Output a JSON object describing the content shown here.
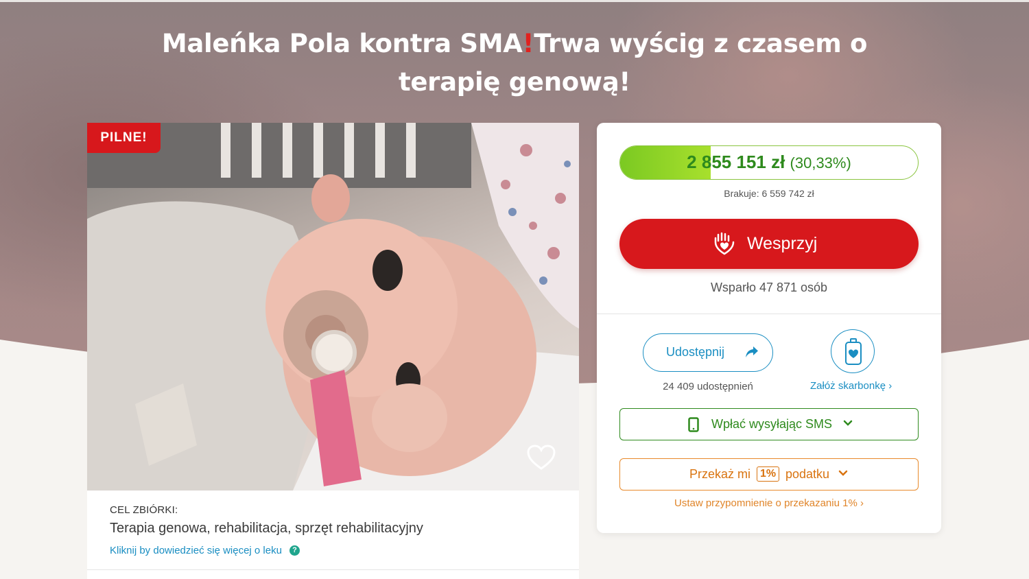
{
  "header": {
    "title_part1": "Maleńka Pola kontra SMA",
    "title_exclamation": "!",
    "title_part2": "Trwa wyścig z czasem o terapię genową!"
  },
  "campaign_card": {
    "badge": "PILNE!",
    "goal_label": "CEL ZBIÓRKI:",
    "goal_text": "Terapia genowa, rehabilitacja, sprzęt rehabilitacyjny",
    "goal_link": "Kliknij by dowiedzieć się więcej o leku",
    "help_glyph": "?",
    "favorite_icon": "heart-outline-icon"
  },
  "donation": {
    "progress": {
      "amount": "2 855 151 zł",
      "percent_label": "(30,33%)",
      "percent_value": 30.33
    },
    "missing": "Brakuje: 6 559 742 zł",
    "support_button": "Wesprzyj",
    "supporters": "Wsparło 47 871 osób",
    "share_button": "Udostępnij",
    "share_count": "24 409 udostępnień",
    "piggy_link": "Załóż skarbonkę",
    "sms_button": "Wpłać wysyłając SMS",
    "tax_button_prefix": "Przekaż mi",
    "tax_badge": "1%",
    "tax_button_suffix": "podatku",
    "tax_reminder": "Ustaw przypomnienie o przekazaniu 1%",
    "colors": {
      "red": "#d7181c",
      "green": "#2e8a1d",
      "blue": "#1a8ec2",
      "orange": "#d9730f"
    }
  }
}
